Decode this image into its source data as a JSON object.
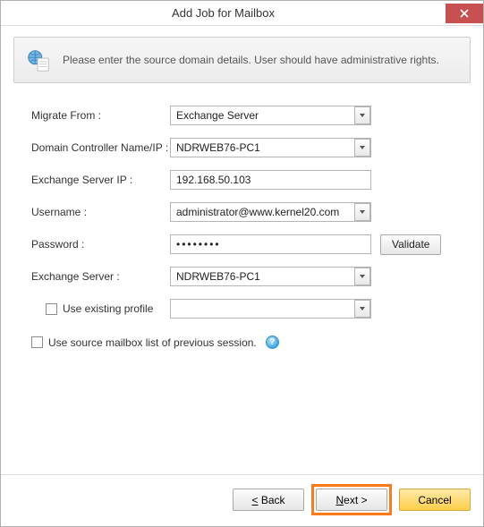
{
  "window": {
    "title": "Add Job for Mailbox"
  },
  "info": {
    "text": "Please enter the source domain details. User should have administrative rights."
  },
  "form": {
    "migrate_from": {
      "label": "Migrate From :",
      "value": "Exchange Server"
    },
    "domain_controller": {
      "label": "Domain Controller Name/IP :",
      "value": "NDRWEB76-PC1"
    },
    "exchange_ip": {
      "label": "Exchange Server IP :",
      "value": "192.168.50.103"
    },
    "username": {
      "label": "Username :",
      "value": "administrator@www.kernel20.com"
    },
    "password": {
      "label": "Password :",
      "value": "••••••••"
    },
    "validate_label": "Validate",
    "exchange_server": {
      "label": "Exchange Server :",
      "value": "NDRWEB76-PC1"
    },
    "use_existing_profile": {
      "label": "Use existing profile",
      "value": ""
    },
    "use_source_session": {
      "label": "Use source mailbox list of previous session."
    }
  },
  "footer": {
    "back": "< Back",
    "next": "Next >",
    "cancel": "Cancel"
  }
}
